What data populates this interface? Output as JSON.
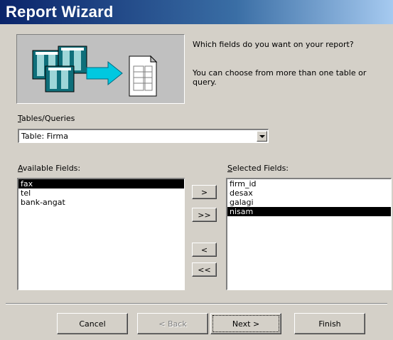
{
  "window": {
    "title": "Report Wizard"
  },
  "prompt": {
    "line1": "Which fields do you want on your report?",
    "line2": "You can choose from more than one table or query."
  },
  "tables_queries": {
    "label_accel": "T",
    "label_rest": "ables/Queries",
    "value": "Table: Firma"
  },
  "available": {
    "label_accel": "A",
    "label_rest": "vailable Fields:",
    "items": [
      "fax",
      "tel",
      "bank-angat"
    ],
    "selected_index": 0
  },
  "selected": {
    "label_accel": "S",
    "label_rest": "elected Fields:",
    "items": [
      "firm_id",
      "desax",
      "galagi",
      "nisam"
    ],
    "selected_index": 3
  },
  "move_buttons": {
    "add_one": ">",
    "add_all": ">>",
    "remove_one": "<",
    "remove_all": "<<"
  },
  "footer": {
    "cancel": "Cancel",
    "back": "< Back",
    "next": "Next >",
    "finish": "Finish"
  },
  "colors": {
    "title_start": "#0a246a",
    "title_end": "#a6caf0",
    "selection": "#000000",
    "face": "#d4d0c8"
  },
  "icons": [
    "tables-to-report-illustration"
  ]
}
